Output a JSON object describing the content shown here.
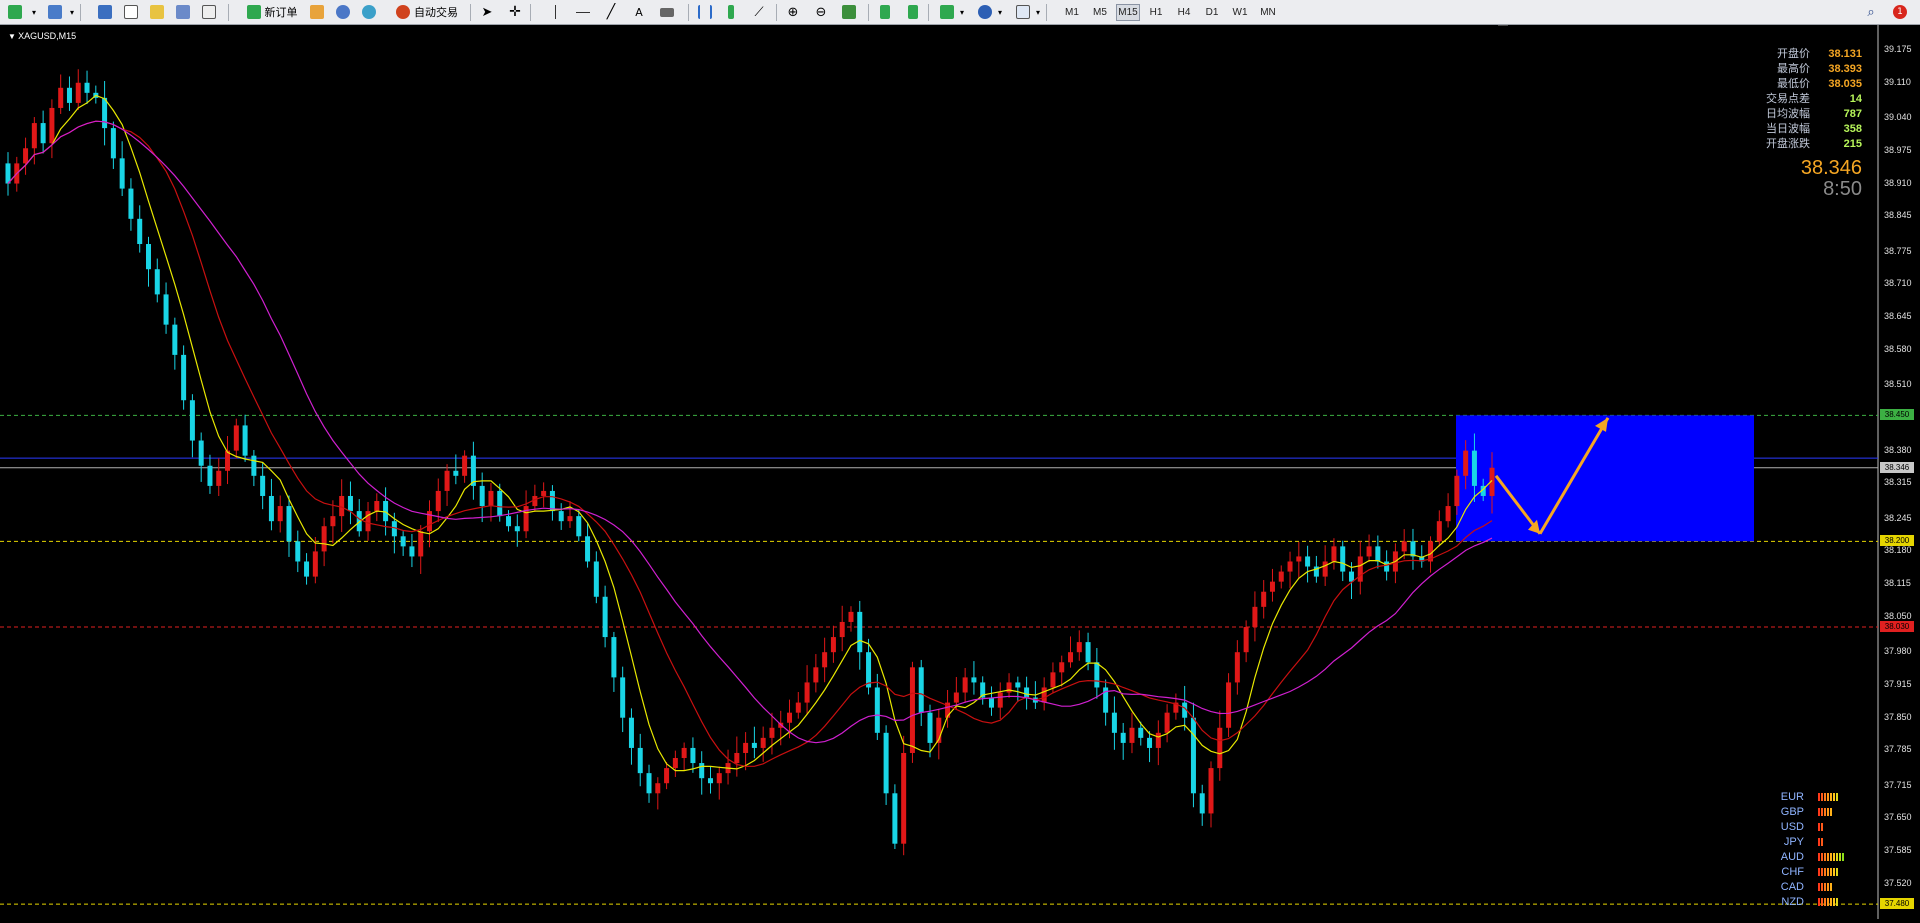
{
  "toolbar": {
    "new_order": "新订单",
    "autotrade": "自动交易",
    "timeframes": [
      "M1",
      "M5",
      "M15",
      "H1",
      "H4",
      "D1",
      "W1",
      "MN"
    ],
    "active_timeframe": "M15"
  },
  "chart": {
    "symbol": "XAGUSD,M15",
    "y_ticks": [
      "39.175",
      "39.110",
      "39.040",
      "38.975",
      "38.910",
      "38.845",
      "38.775",
      "38.710",
      "38.645",
      "38.580",
      "38.510",
      "38.380",
      "38.315",
      "38.245",
      "38.180",
      "38.115",
      "38.050",
      "37.980",
      "37.915",
      "37.850",
      "37.785",
      "37.715",
      "37.650",
      "37.585",
      "37.520"
    ],
    "price_labels": [
      {
        "text": "38.450",
        "color": "#3cb043"
      },
      {
        "text": "38.346",
        "color": "#c8c8c8"
      },
      {
        "text": "38.200",
        "color": "#e5d500"
      },
      {
        "text": "38.030",
        "color": "#e02020"
      },
      {
        "text": "37.480",
        "color": "#e5d500"
      }
    ]
  },
  "info": {
    "rows": [
      {
        "label": "开盘价",
        "value": "38.131",
        "color": "#f5a623"
      },
      {
        "label": "最高价",
        "value": "38.393",
        "color": "#f5a623"
      },
      {
        "label": "最低价",
        "value": "38.035",
        "color": "#f5a623"
      },
      {
        "label": "交易点差",
        "value": "14",
        "color": "#b7f55a"
      },
      {
        "label": "日均波幅",
        "value": "787",
        "color": "#b7f55a"
      },
      {
        "label": "当日波幅",
        "value": "358",
        "color": "#b7f55a"
      },
      {
        "label": "开盘涨跌",
        "value": "215",
        "color": "#b7f55a"
      }
    ],
    "current_price": "38.346",
    "countdown": "8:50"
  },
  "strength": [
    {
      "currency": "EUR",
      "bars": 7
    },
    {
      "currency": "GBP",
      "bars": 5
    },
    {
      "currency": "USD",
      "bars": 2
    },
    {
      "currency": "JPY",
      "bars": 2
    },
    {
      "currency": "AUD",
      "bars": 9
    },
    {
      "currency": "CHF",
      "bars": 7
    },
    {
      "currency": "CAD",
      "bars": 5
    },
    {
      "currency": "NZD",
      "bars": 7
    }
  ],
  "colors": {
    "bull": "#e01818",
    "bear": "#19d5e6",
    "ma_fast": "#e8e800",
    "ma_mid": "#c81010",
    "ma_slow": "#d020d0",
    "zone": "#0000ff",
    "arrow": "#f5a623",
    "line_green": "#3cb043",
    "line_yellow": "#e5d500",
    "line_red": "#e02020",
    "line_blue": "#2b3bff"
  },
  "chart_data": {
    "type": "candlestick",
    "closes": [
      38.91,
      38.95,
      38.98,
      39.03,
      38.99,
      39.06,
      39.1,
      39.07,
      39.11,
      39.09,
      39.08,
      39.02,
      38.96,
      38.9,
      38.84,
      38.79,
      38.74,
      38.69,
      38.63,
      38.57,
      38.48,
      38.4,
      38.35,
      38.31,
      38.34,
      38.38,
      38.43,
      38.37,
      38.33,
      38.29,
      38.24,
      38.27,
      38.2,
      38.16,
      38.13,
      38.18,
      38.23,
      38.25,
      38.29,
      38.26,
      38.22,
      38.26,
      38.28,
      38.24,
      38.21,
      38.19,
      38.17,
      38.22,
      38.26,
      38.3,
      38.34,
      38.33,
      38.37,
      38.31,
      38.27,
      38.3,
      38.25,
      38.23,
      38.22,
      38.27,
      38.29,
      38.3,
      38.26,
      38.24,
      38.25,
      38.21,
      38.16,
      38.09,
      38.01,
      37.93,
      37.85,
      37.79,
      37.74,
      37.7,
      37.72,
      37.75,
      37.77,
      37.79,
      37.76,
      37.73,
      37.72,
      37.74,
      37.76,
      37.78,
      37.8,
      37.79,
      37.81,
      37.83,
      37.84,
      37.86,
      37.88,
      37.92,
      37.95,
      37.98,
      38.01,
      38.04,
      38.06,
      37.98,
      37.91,
      37.82,
      37.7,
      37.6,
      37.78,
      37.95,
      37.86,
      37.8,
      37.85,
      37.88,
      37.9,
      37.93,
      37.92,
      37.89,
      37.87,
      37.9,
      37.92,
      37.91,
      37.89,
      37.88,
      37.91,
      37.94,
      37.96,
      37.98,
      38.0,
      37.96,
      37.91,
      37.86,
      37.82,
      37.8,
      37.83,
      37.81,
      37.79,
      37.82,
      37.86,
      37.88,
      37.85,
      37.7,
      37.66,
      37.75,
      37.83,
      37.92,
      37.98,
      38.03,
      38.07,
      38.1,
      38.12,
      38.14,
      38.16,
      38.17,
      38.15,
      38.13,
      38.16,
      38.19,
      38.14,
      38.12,
      38.17,
      38.19,
      38.16,
      38.14,
      38.18,
      38.2,
      38.17,
      38.16,
      38.2,
      38.24,
      38.27,
      38.33,
      38.38,
      38.31,
      38.29,
      38.346
    ]
  }
}
